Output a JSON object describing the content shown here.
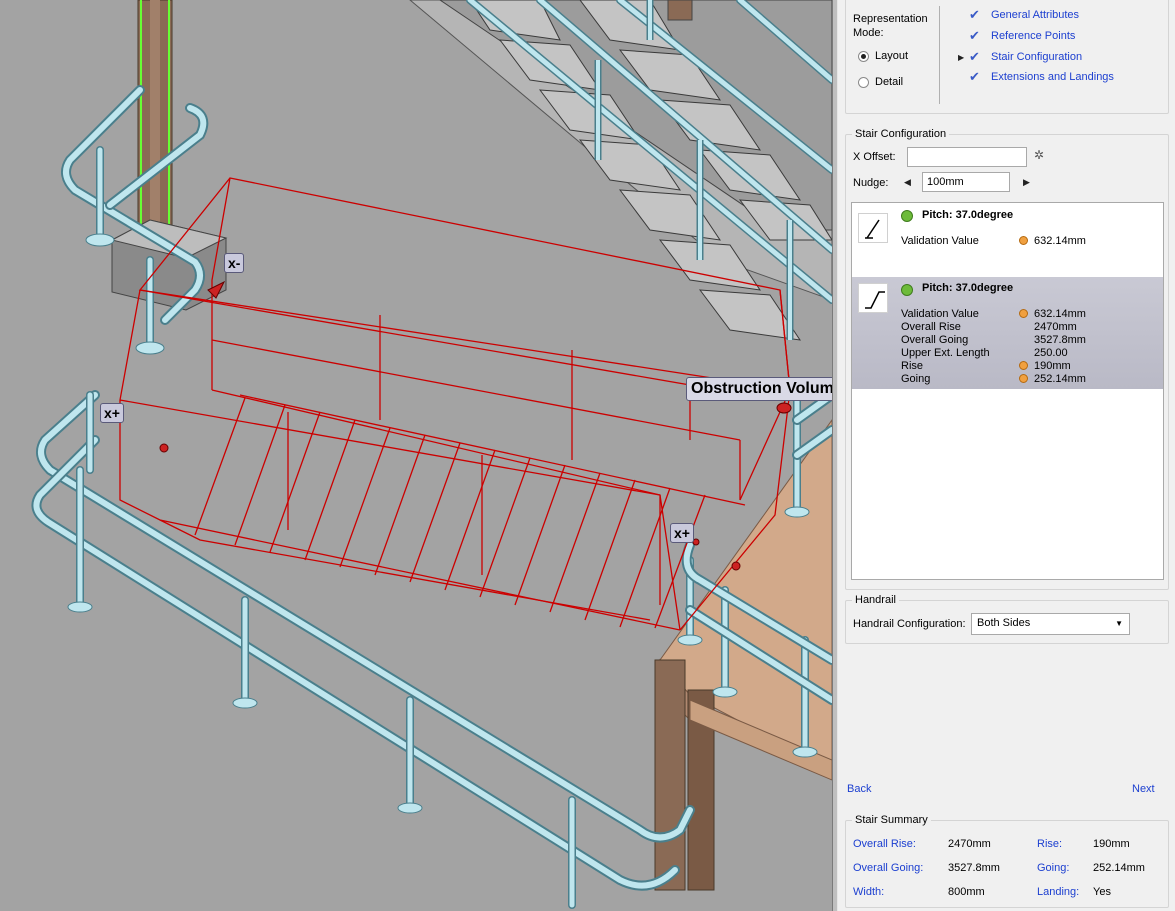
{
  "viewport": {
    "labels": {
      "x_minus": "x-",
      "x_plus_left": "x+",
      "x_plus_right": "x+",
      "obstruction": "Obstruction Volume"
    },
    "colors": {
      "background": "#a3a3a3",
      "wireframe": "#cc0000",
      "handrail": "#bfe6ee",
      "handrail_edge": "#4a7f8c",
      "column": "#8a6a55",
      "column_highlight": "#66ff33",
      "landing": "#d2a98a"
    }
  },
  "panel": {
    "representation": {
      "label_line1": "Representation",
      "label_line2": "Mode:",
      "options": [
        {
          "label": "Layout",
          "selected": true
        },
        {
          "label": "Detail",
          "selected": false
        }
      ]
    },
    "nav": {
      "items": [
        {
          "label": "General Attributes",
          "icon": "check-icon",
          "current": false
        },
        {
          "label": "Reference Points",
          "icon": "check-icon",
          "current": false
        },
        {
          "label": "Stair Configuration",
          "icon": "check-icon",
          "current": true
        },
        {
          "label": "Extensions and Landings",
          "icon": "check-icon",
          "current": false
        }
      ]
    },
    "stair_config": {
      "title": "Stair Configuration",
      "x_offset_label": "X Offset:",
      "x_offset_value": "",
      "nudge_label": "Nudge:",
      "nudge_value": "100mm",
      "options": [
        {
          "title": "Pitch: 37.0degree",
          "status": "green",
          "rows": [
            {
              "label": "Validation Value",
              "value": "632.14mm",
              "flag": true
            }
          ],
          "selected": false
        },
        {
          "title": "Pitch: 37.0degree",
          "status": "green",
          "rows": [
            {
              "label": "Validation Value",
              "value": "632.14mm",
              "flag": true
            },
            {
              "label": "Overall Rise",
              "value": "2470mm",
              "flag": false
            },
            {
              "label": "Overall Going",
              "value": "3527.8mm",
              "flag": false
            },
            {
              "label": "Upper Ext. Length",
              "value": "250.00",
              "flag": false
            },
            {
              "label": "Rise",
              "value": "190mm",
              "flag": true
            },
            {
              "label": "Going",
              "value": "252.14mm",
              "flag": true
            }
          ],
          "selected": true
        }
      ]
    },
    "handrail": {
      "title": "Handrail",
      "config_label": "Handrail Configuration:",
      "config_value": "Both Sides"
    },
    "buttons": {
      "back": "Back",
      "next": "Next"
    },
    "summary": {
      "title": "Stair Summary",
      "items": [
        {
          "label": "Overall Rise:",
          "value": "2470mm"
        },
        {
          "label": "Rise:",
          "value": "190mm"
        },
        {
          "label": "Overall Going:",
          "value": "3527.8mm"
        },
        {
          "label": "Going:",
          "value": "252.14mm"
        },
        {
          "label": "Width:",
          "value": "800mm"
        },
        {
          "label": "Landing:",
          "value": "Yes"
        }
      ]
    }
  }
}
